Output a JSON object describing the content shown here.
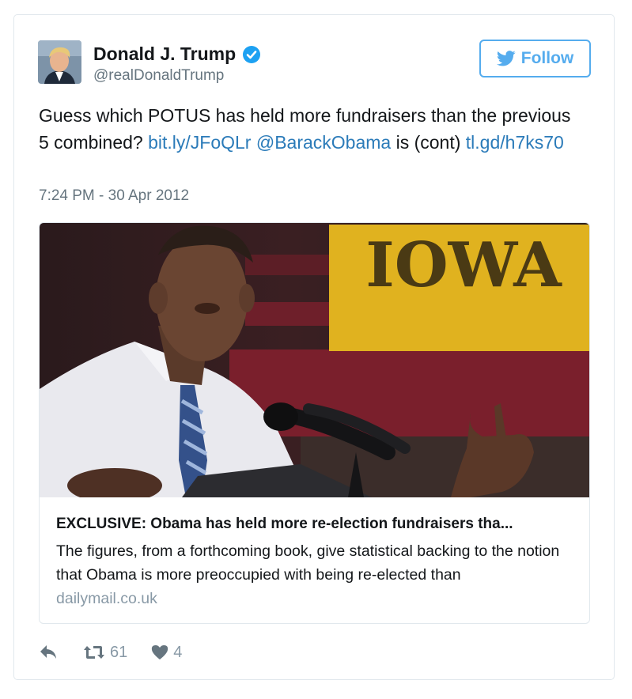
{
  "author": {
    "name": "Donald J. Trump",
    "handle": "@realDonaldTrump",
    "verified_icon": "verified-badge-icon"
  },
  "follow_button": {
    "label": "Follow",
    "icon": "twitter-bird-icon"
  },
  "tweet": {
    "text_lead": "Guess which POTUS has held more fundraisers than the previous 5 combined? ",
    "link_1": "bit.ly/JFoQLr",
    "mention": "@BarackObama",
    "text_mid": " is (cont) ",
    "link_2": "tl.gd/h7ks70",
    "timestamp": "7:24 PM - 30 Apr 2012"
  },
  "card": {
    "sign_text": "IOWA",
    "title": "EXCLUSIVE: Obama has held more re-election fundraisers tha...",
    "description": "The figures, from a forthcoming book, give statistical backing to the notion that Obama is more preoccupied with being re-elected than",
    "domain": "dailymail.co.uk"
  },
  "actions": {
    "reply_icon": "reply-icon",
    "retweet_icon": "retweet-icon",
    "retweet_count": "61",
    "like_icon": "heart-icon",
    "like_count": "4"
  },
  "colors": {
    "link": "#2b7bb9",
    "twitter_blue": "#55acee",
    "muted": "#66757f",
    "action_gray": "#8899a6",
    "border": "#e1e8ed"
  }
}
